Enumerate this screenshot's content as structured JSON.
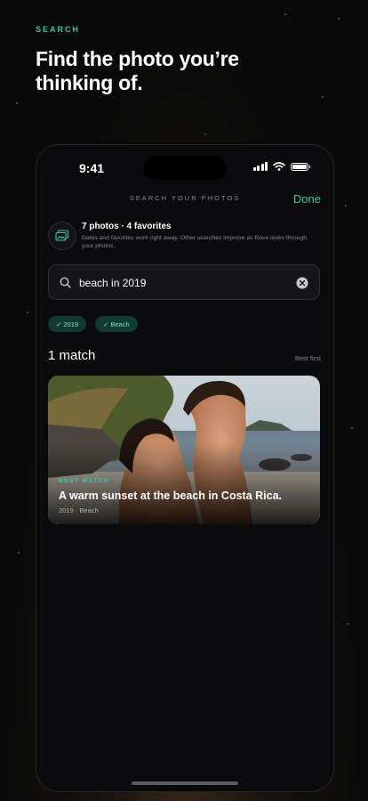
{
  "header": {
    "eyebrow": "SEARCH",
    "headline": "Find the photo you’re thinking of."
  },
  "status_bar": {
    "time": "9:41"
  },
  "nav": {
    "title": "SEARCH YOUR PHOTOS",
    "done_label": "Done"
  },
  "library_info": {
    "title": "7 photos · 4 favorites",
    "description": "Dates and favorites work right away. Other searches improve as Rove looks through your photos."
  },
  "search": {
    "query": "beach in 2019"
  },
  "filters": [
    {
      "label": "✓ 2019"
    },
    {
      "label": "✓ Beach"
    }
  ],
  "results": {
    "count_label": "1 match",
    "sort_label": "Best first",
    "items": [
      {
        "badge": "BEST MATCH",
        "title": "A warm sunset at the beach in Costa Rica.",
        "meta": "2019 · Beach"
      }
    ]
  },
  "colors": {
    "accent": "#39c9a4",
    "chip_bg": "#113a30",
    "background": "#0b0b0d"
  }
}
